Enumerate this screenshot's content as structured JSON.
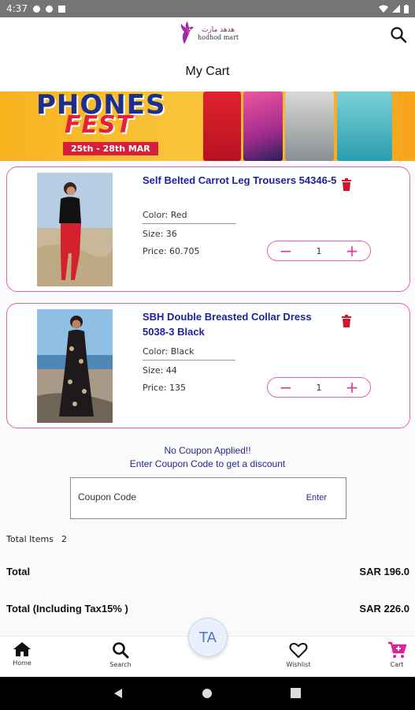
{
  "status_bar": {
    "time": "4:37"
  },
  "header": {
    "logo_arabic": "هدهد مارت",
    "logo_english": "hodhod mart",
    "title": "My Cart"
  },
  "banner": {
    "line1": "PHONES",
    "line2": "FEST",
    "dates": "25th - 28th MAR"
  },
  "cart_items": [
    {
      "name": "Self Belted Carrot Leg Trousers 54346-5",
      "color": "Color: Red",
      "size": "Size: 36",
      "price": "Price: 60.705",
      "qty": "1"
    },
    {
      "name": "SBH Double Breasted Collar Dress 5038-3 Black",
      "color": "Color: Black",
      "size": "Size: 44",
      "price": "Price: 135",
      "qty": "1"
    }
  ],
  "coupon": {
    "line1": "No Coupon Applied!!",
    "line2": "Enter Coupon Code to get a discount",
    "placeholder": "Coupon Code",
    "enter_label": "Enter"
  },
  "summary": {
    "total_items_label": "Total Items",
    "total_items_value": "2",
    "total_label": "Total",
    "total_value": "SAR 196.0",
    "total_tax_label": "Total (Including Tax15% )",
    "total_tax_value": "SAR 226.0"
  },
  "fab_label": "TA",
  "bottom_nav": {
    "home": "Home",
    "search": "Search",
    "wishlist": "Wishlist",
    "cart": "Cart"
  },
  "colors": {
    "accent_pink": "#e55fb6",
    "title_blue": "#1f1f9b",
    "delete_red": "#d0142c",
    "cart_magenta": "#e0209a"
  }
}
